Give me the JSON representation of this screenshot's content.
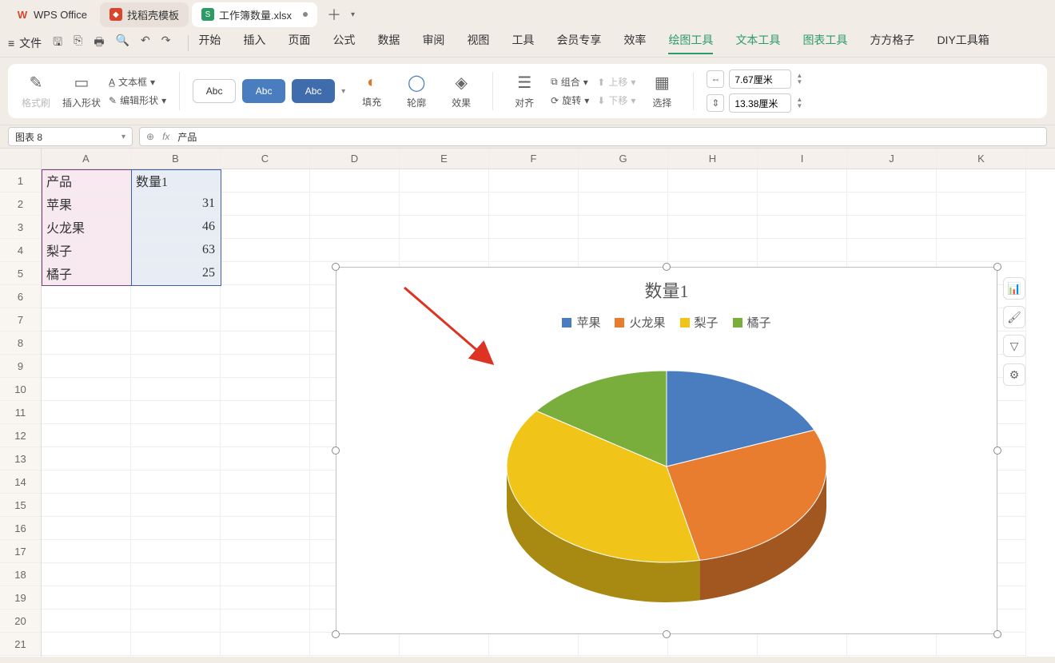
{
  "titlebar": {
    "app_name": "WPS Office",
    "template_tab": "找稻壳模板",
    "doc_tab": "工作簿数量.xlsx",
    "xls_glyph": "S"
  },
  "menubar": {
    "file": "文件",
    "items": [
      "开始",
      "插入",
      "页面",
      "公式",
      "数据",
      "审阅",
      "视图",
      "工具",
      "会员专享",
      "效率",
      "绘图工具",
      "文本工具",
      "图表工具",
      "方方格子",
      "DIY工具箱"
    ],
    "active_index": 10,
    "green_indices": [
      10,
      11,
      12
    ]
  },
  "ribbon": {
    "format_painter": "格式刷",
    "insert_shape": "插入形状",
    "text_box": "文本框",
    "edit_shape": "编辑形状",
    "style_labels": [
      "Abc",
      "Abc",
      "Abc"
    ],
    "fill": "填充",
    "outline": "轮廓",
    "effects": "效果",
    "align": "对齐",
    "group": "组合",
    "rotate": "旋转",
    "move_up": "上移",
    "move_down": "下移",
    "select": "选择",
    "width_value": "7.67厘米",
    "height_value": "13.38厘米"
  },
  "formula_bar": {
    "name_box": "图表 8",
    "formula_value": "产品"
  },
  "grid": {
    "columns": [
      "A",
      "B",
      "C",
      "D",
      "E",
      "F",
      "G",
      "H",
      "I",
      "J",
      "K"
    ],
    "row_count": 21,
    "header_row": {
      "A": "产品",
      "B": "数量1"
    },
    "data_rows": [
      {
        "A": "苹果",
        "B": 31
      },
      {
        "A": "火龙果",
        "B": 46
      },
      {
        "A": "梨子",
        "B": 63
      },
      {
        "A": "橘子",
        "B": 25
      }
    ]
  },
  "chart_data": {
    "type": "pie",
    "title": "数量1",
    "categories": [
      "苹果",
      "火龙果",
      "梨子",
      "橘子"
    ],
    "values": [
      31,
      46,
      63,
      25
    ],
    "colors": [
      "#4a7dbf",
      "#e87c2f",
      "#f0c419",
      "#7aae3c"
    ]
  },
  "side_buttons": [
    "chart-type",
    "brush",
    "filter",
    "settings"
  ]
}
